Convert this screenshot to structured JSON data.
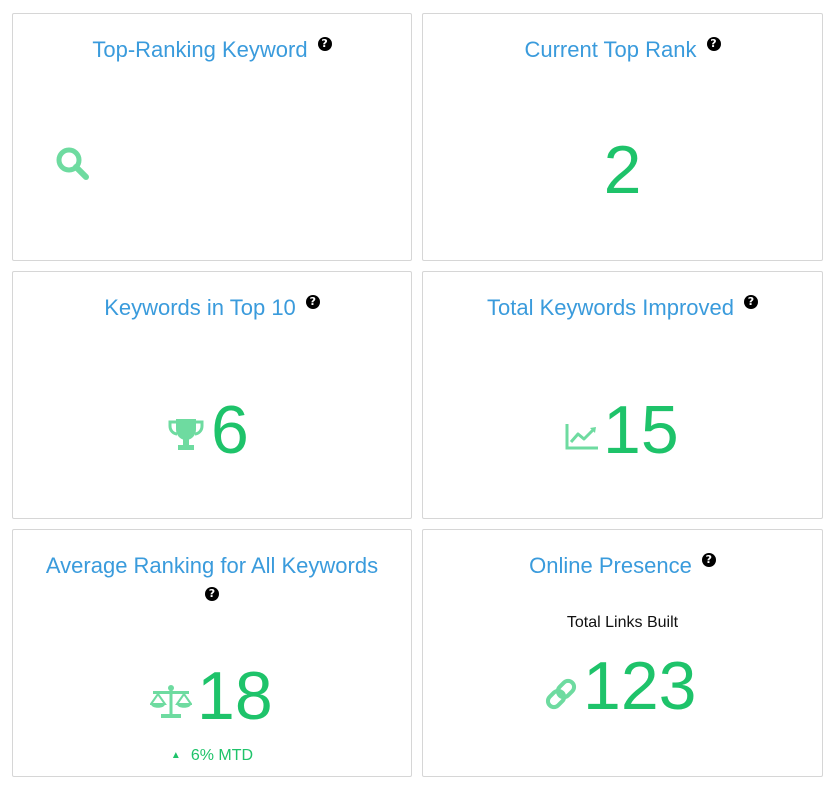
{
  "colors": {
    "title": "#3a9bdc",
    "value": "#1ec36a",
    "icon": "#6edba0"
  },
  "cards": {
    "top_keyword": {
      "title": "Top-Ranking Keyword",
      "icon": "search-icon"
    },
    "top_rank": {
      "title": "Current Top Rank",
      "value": "2"
    },
    "top10": {
      "title": "Keywords in Top 10",
      "value": "6",
      "icon": "trophy-icon"
    },
    "improved": {
      "title": "Total Keywords Improved",
      "value": "15",
      "icon": "area-chart-icon"
    },
    "avg_rank": {
      "title": "Average Ranking for All Keywords",
      "value": "18",
      "icon": "balance-scale-icon",
      "trend_text": "6% MTD",
      "trend_direction": "up"
    },
    "presence": {
      "title": "Online Presence",
      "sublabel": "Total Links Built",
      "value": "123",
      "icon": "link-icon"
    }
  }
}
